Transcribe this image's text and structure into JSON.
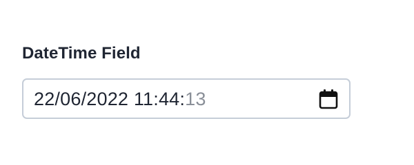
{
  "field": {
    "label": "DateTime Field",
    "value_main": "22/06/2022 11:44",
    "value_separator": ":",
    "value_seconds": "13"
  },
  "icons": {
    "picker": "calendar-icon"
  },
  "colors": {
    "text": "#1f2532",
    "placeholder_segment": "#8a8f98",
    "border": "#c5cdd8",
    "background": "#ffffff"
  }
}
